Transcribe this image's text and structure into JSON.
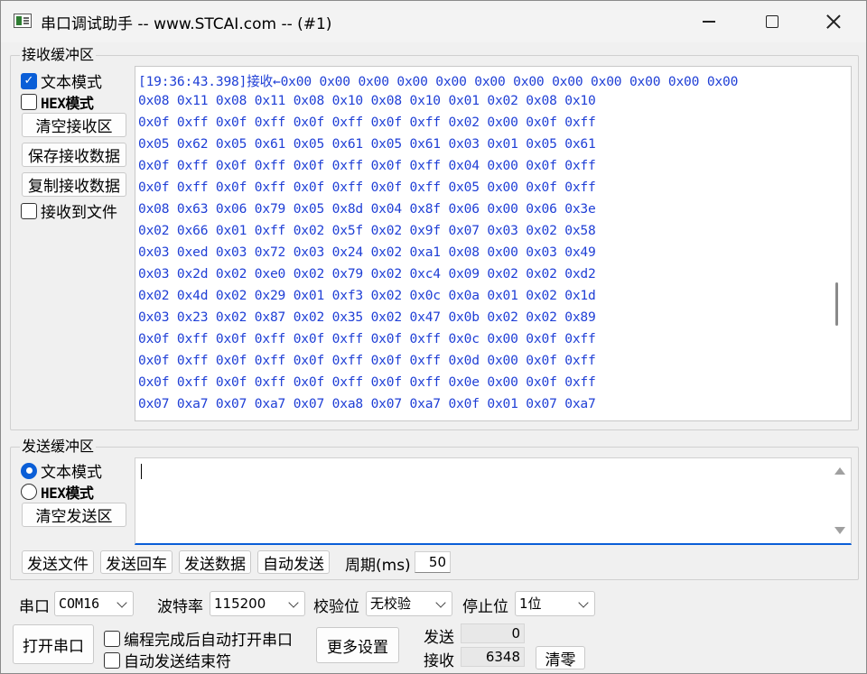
{
  "window": {
    "title": "串口调试助手 -- www.STCAI.com -- (#1)"
  },
  "receive": {
    "group_label": "接收缓冲区",
    "text_mode_label": "文本模式",
    "hex_mode_label": "HEX模式",
    "text_mode_checked": true,
    "hex_mode_checked": false,
    "save_to_file_label": "接收到文件",
    "buttons": {
      "clear": "清空接收区",
      "save": "保存接收数据",
      "copy": "复制接收数据"
    },
    "lines": [
      "[19:36:43.398]接收←0x00 0x00 0x00 0x00 0x00 0x00 0x00 0x00 0x00 0x00 0x00 0x00",
      "0x08 0x11 0x08 0x11 0x08 0x10 0x08 0x10 0x01 0x02 0x08 0x10",
      "0x0f 0xff 0x0f 0xff 0x0f 0xff 0x0f 0xff 0x02 0x00 0x0f 0xff",
      "0x05 0x62 0x05 0x61 0x05 0x61 0x05 0x61 0x03 0x01 0x05 0x61",
      "0x0f 0xff 0x0f 0xff 0x0f 0xff 0x0f 0xff 0x04 0x00 0x0f 0xff",
      "0x0f 0xff 0x0f 0xff 0x0f 0xff 0x0f 0xff 0x05 0x00 0x0f 0xff",
      "0x08 0x63 0x06 0x79 0x05 0x8d 0x04 0x8f 0x06 0x00 0x06 0x3e",
      "0x02 0x66 0x01 0xff 0x02 0x5f 0x02 0x9f 0x07 0x03 0x02 0x58",
      "0x03 0xed 0x03 0x72 0x03 0x24 0x02 0xa1 0x08 0x00 0x03 0x49",
      "0x03 0x2d 0x02 0xe0 0x02 0x79 0x02 0xc4 0x09 0x02 0x02 0xd2",
      "0x02 0x4d 0x02 0x29 0x01 0xf3 0x02 0x0c 0x0a 0x01 0x02 0x1d",
      "0x03 0x23 0x02 0x87 0x02 0x35 0x02 0x47 0x0b 0x02 0x02 0x89",
      "0x0f 0xff 0x0f 0xff 0x0f 0xff 0x0f 0xff 0x0c 0x00 0x0f 0xff",
      "0x0f 0xff 0x0f 0xff 0x0f 0xff 0x0f 0xff 0x0d 0x00 0x0f 0xff",
      "0x0f 0xff 0x0f 0xff 0x0f 0xff 0x0f 0xff 0x0e 0x00 0x0f 0xff",
      "0x07 0xa7 0x07 0xa7 0x07 0xa8 0x07 0xa7 0x0f 0x01 0x07 0xa7"
    ]
  },
  "send": {
    "group_label": "发送缓冲区",
    "text_mode_label": "文本模式",
    "hex_mode_label": "HEX模式",
    "text_mode_selected": true,
    "clear_button": "清空发送区",
    "input_value": "",
    "buttons": {
      "send_file": "发送文件",
      "send_enter": "发送回车",
      "send_data": "发送数据",
      "auto_send": "自动发送"
    },
    "period_label": "周期(ms)",
    "period_value": "50"
  },
  "serial": {
    "port_label": "串口",
    "port_value": "COM16",
    "baud_label": "波特率",
    "baud_value": "115200",
    "parity_label": "校验位",
    "parity_value": "无校验",
    "stopbits_label": "停止位",
    "stopbits_value": "1位",
    "open_button": "打开串口",
    "auto_open_label": "编程完成后自动打开串口",
    "auto_open_checked": false,
    "auto_end_label": "自动发送结束符",
    "auto_end_checked": false,
    "more_settings_button": "更多设置",
    "sent_label": "发送",
    "sent_count": "0",
    "recv_label": "接收",
    "recv_count": "6348",
    "clear_counts_button": "清零"
  },
  "icons": {
    "app": "app-icon",
    "minimize": "minimize-icon",
    "maximize": "maximize-icon",
    "close": "close-icon"
  },
  "colors": {
    "accent": "#0a5ed7",
    "received_text": "#1f3fd6"
  }
}
